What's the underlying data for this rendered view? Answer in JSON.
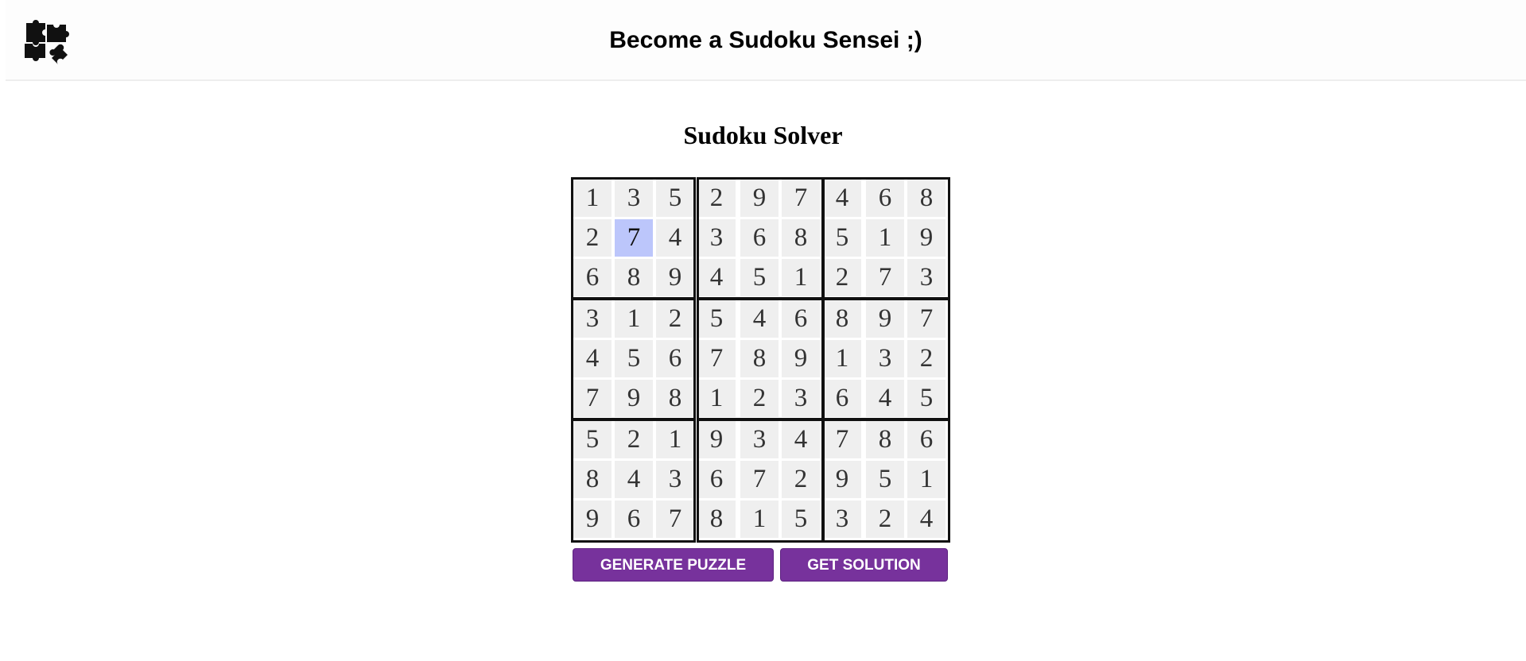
{
  "header": {
    "title": "Become a Sudoku Sensei ;)",
    "logo_icon": "puzzle-pieces-icon"
  },
  "main": {
    "title": "Sudoku Solver"
  },
  "grid": {
    "rows": [
      [
        "1",
        "3",
        "5",
        "2",
        "9",
        "7",
        "4",
        "6",
        "8"
      ],
      [
        "2",
        "7",
        "4",
        "3",
        "6",
        "8",
        "5",
        "1",
        "9"
      ],
      [
        "6",
        "8",
        "9",
        "4",
        "5",
        "1",
        "2",
        "7",
        "3"
      ],
      [
        "3",
        "1",
        "2",
        "5",
        "4",
        "6",
        "8",
        "9",
        "7"
      ],
      [
        "4",
        "5",
        "6",
        "7",
        "8",
        "9",
        "1",
        "3",
        "2"
      ],
      [
        "7",
        "9",
        "8",
        "1",
        "2",
        "3",
        "6",
        "4",
        "5"
      ],
      [
        "5",
        "2",
        "1",
        "9",
        "3",
        "4",
        "7",
        "8",
        "6"
      ],
      [
        "8",
        "4",
        "3",
        "6",
        "7",
        "2",
        "9",
        "5",
        "1"
      ],
      [
        "9",
        "6",
        "7",
        "8",
        "1",
        "5",
        "3",
        "2",
        "4"
      ]
    ],
    "selected_cell": {
      "row": 2,
      "col": 2
    },
    "colors": {
      "cell_background": "#efefef",
      "selected_background": "#bcc6fb",
      "box_border": "#111111"
    }
  },
  "buttons": {
    "generate_label": "GENERATE PUZZLE",
    "solution_label": "GET SOLUTION",
    "color": "#77329c"
  }
}
